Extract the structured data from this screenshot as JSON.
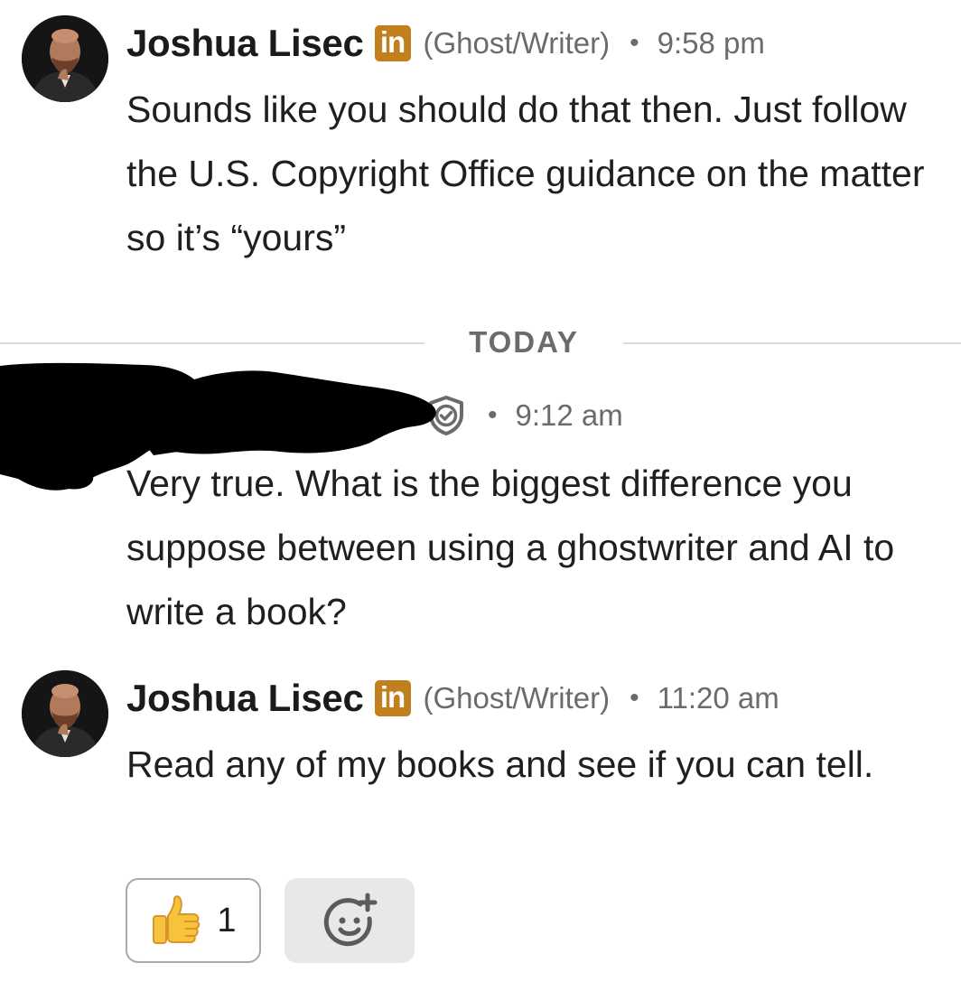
{
  "messages": [
    {
      "sender": "Joshua Lisec",
      "badge": "in",
      "headline": "(Ghost/Writer)",
      "separator": "•",
      "time": "9:58 pm",
      "text": "Sounds like you should do that then. Just follow the U.S. Copyright Office guidance on the matter so it’s “yours”"
    },
    {
      "separator": "•",
      "time": "9:12 am",
      "text": "Very true. What is the biggest difference you suppose between using a ghostwriter and AI to write a book?"
    },
    {
      "sender": "Joshua Lisec",
      "badge": "in",
      "headline": "(Ghost/Writer)",
      "separator": "•",
      "time": "11:20 am",
      "text": "Read any of my books and see if you can tell."
    }
  ],
  "day_divider": "TODAY",
  "reactions": [
    {
      "emoji": "thumbs-up",
      "count": "1"
    }
  ],
  "icons": {
    "verified": "shield-check-icon",
    "add_reaction": "add-reaction-icon"
  },
  "colors": {
    "linkedin_badge": "#c17f1e",
    "meta_text": "#6b6b6b",
    "body_text": "#1f1f1f"
  }
}
